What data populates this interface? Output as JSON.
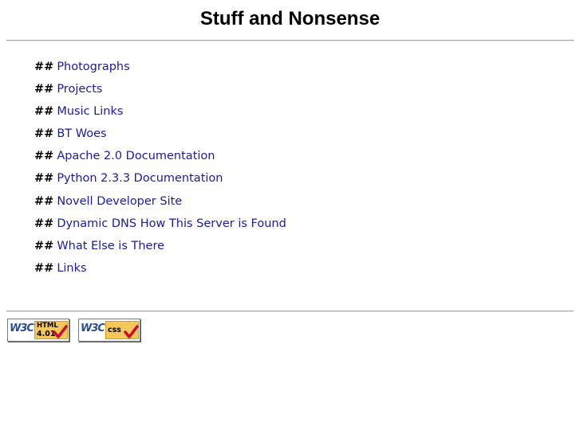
{
  "header": {
    "title": "Stuff and Nonsense"
  },
  "nav": {
    "bullet": "##",
    "items": [
      {
        "label": "Photographs"
      },
      {
        "label": "Projects"
      },
      {
        "label": "Music Links"
      },
      {
        "label": "BT Woes"
      },
      {
        "label": "Apache 2.0 Documentation"
      },
      {
        "label": "Python 2.3.3 Documentation"
      },
      {
        "label": "Novell Developer Site"
      },
      {
        "label": "Dynamic DNS How This Server is Found"
      },
      {
        "label": "What Else is There"
      },
      {
        "label": "Links"
      }
    ]
  },
  "footer": {
    "badges": [
      {
        "logo": "W3C",
        "line1": "HTML",
        "line2": "4.01"
      },
      {
        "logo": "W3C",
        "line1": "css"
      }
    ]
  },
  "colors": {
    "link": "#1a1aa6",
    "badge_tag": "#f6c75a",
    "check": "#c8102e"
  }
}
